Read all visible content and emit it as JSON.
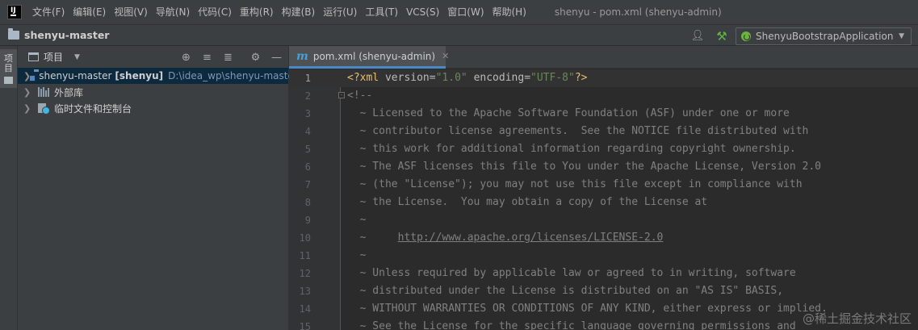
{
  "app": {
    "logo_text": "IJ",
    "window_title": "shenyu - pom.xml (shenyu-admin)"
  },
  "menu": [
    {
      "label": "文件(F)"
    },
    {
      "label": "编辑(E)"
    },
    {
      "label": "视图(V)"
    },
    {
      "label": "导航(N)"
    },
    {
      "label": "代码(C)"
    },
    {
      "label": "重构(R)"
    },
    {
      "label": "构建(B)"
    },
    {
      "label": "运行(U)"
    },
    {
      "label": "工具(T)"
    },
    {
      "label": "VCS(S)"
    },
    {
      "label": "窗口(W)"
    },
    {
      "label": "帮助(H)"
    }
  ],
  "navbar": {
    "project_name": "shenyu-master",
    "run_config": "ShenyuBootstrapApplication",
    "icons": {
      "vcs": "user-icon",
      "build": "hammer-icon",
      "config": "spring-icon"
    }
  },
  "toolstrip": {
    "project_label": "项目"
  },
  "project_panel": {
    "title": "项目",
    "tree": [
      {
        "name": "shenyu-master",
        "module": "[shenyu]",
        "path": "D:\\idea_wp\\shenyu-maste",
        "icon": "module-folder-icon"
      },
      {
        "name": "外部库",
        "icon": "library-icon"
      },
      {
        "name": "临时文件和控制台",
        "icon": "scratch-icon"
      }
    ]
  },
  "editor": {
    "tab_label": "pom.xml (shenyu-admin)",
    "tab_icon": "maven-icon",
    "lines": [
      {
        "n": "1"
      },
      {
        "n": "2",
        "text": "<!--"
      },
      {
        "n": "3",
        "text": "  ~ Licensed to the Apache Software Foundation (ASF) under one or more"
      },
      {
        "n": "4",
        "text": "  ~ contributor license agreements.  See the NOTICE file distributed with"
      },
      {
        "n": "5",
        "text": "  ~ this work for additional information regarding copyright ownership."
      },
      {
        "n": "6",
        "text": "  ~ The ASF licenses this file to You under the Apache License, Version 2.0"
      },
      {
        "n": "7",
        "text": "  ~ (the \"License\"); you may not use this file except in compliance with"
      },
      {
        "n": "8",
        "text": "  ~ the License.  You may obtain a copy of the License at"
      },
      {
        "n": "9",
        "text": "  ~"
      },
      {
        "n": "10",
        "prefix": "  ~     ",
        "link": "http://www.apache.org/licenses/LICENSE-2.0"
      },
      {
        "n": "11",
        "text": "  ~"
      },
      {
        "n": "12",
        "text": "  ~ Unless required by applicable law or agreed to in writing, software"
      },
      {
        "n": "13",
        "text": "  ~ distributed under the License is distributed on an \"AS IS\" BASIS,"
      },
      {
        "n": "14",
        "text": "  ~ WITHOUT WARRANTIES OR CONDITIONS OF ANY KIND, either express or implied."
      },
      {
        "n": "15",
        "text": "  ~ See the License for the specific language governing permissions and"
      }
    ],
    "line1": {
      "open": "<?xml ",
      "attr1": "version",
      "eq1": "=",
      "val1": "\"1.0\"",
      "sp": " ",
      "attr2": "encoding",
      "eq2": "=",
      "val2": "\"UTF-8\"",
      "close": "?>"
    },
    "watermark": "@稀土掘金技术社区"
  },
  "colors": {
    "background": "#2b2b2b",
    "chrome": "#3c3f41",
    "accent": "#4a88c7",
    "comment": "#808080",
    "xml_tag": "#e8bf6a",
    "string": "#6a8759"
  }
}
